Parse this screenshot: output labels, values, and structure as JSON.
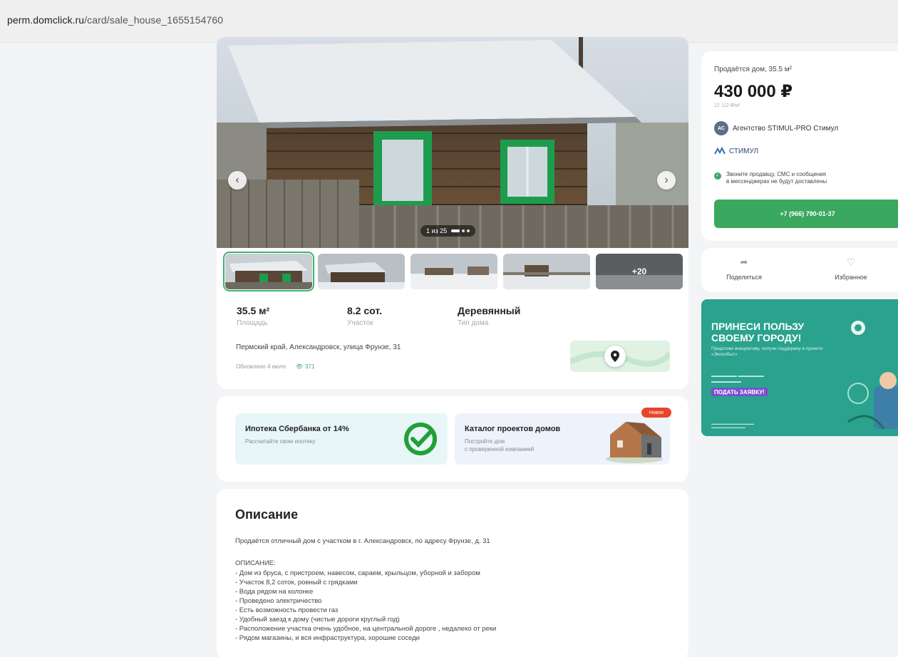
{
  "browser": {
    "url_host": "perm.domclick.ru",
    "url_path": "/card/sale_house_1655154760"
  },
  "gallery": {
    "counter": "1 из 25",
    "more_label": "+20"
  },
  "specs": [
    {
      "value": "35.5 м²",
      "label": "Площадь"
    },
    {
      "value": "8.2 сот.",
      "label": "Участок"
    },
    {
      "value": "Деревянный",
      "label": "Тип дома"
    }
  ],
  "address": "Пермский край, Александровск, улица Фрунзе, 31",
  "updated": "Обновлено 4 июля",
  "views": "371",
  "promos": {
    "mortgage_title": "Ипотека Сбербанка от 14%",
    "mortgage_sub": "Рассчитайте свою ипотеку",
    "catalog_title": "Каталог проектов домов",
    "catalog_sub_1": "Постройте дом",
    "catalog_sub_2": "с проверенной компанией",
    "new_badge": "Новое"
  },
  "description": {
    "title": "Описание",
    "intro": "Продаётся отличный дом с участком в г. Александровск, по адресу Фрунзе, д. 31",
    "heading": "ОПИСАНИЕ:",
    "items": [
      "- Дом из бруса, с пристроем, навесом, сараем, крыльцом, уборной и забором",
      "- Участок 8,2 соток, ровный с грядками",
      "- Вода рядом на колонке",
      "- Проведено электричество",
      "- Есть возможность провести газ",
      "- Удобный заезд к дому (чистые дороги круглый год)",
      "- Расположение участка очень удобное, на центральной дороге , недалеко от реки",
      "- Рядом магазины, и вся инфраструктура, хорошие соседи"
    ]
  },
  "sale": {
    "subtitle": "Продаётся дом, 35.5 м²",
    "price": "430 000 ₽",
    "price_per_sqm": "12 112 ₽/м²",
    "agency_initials": "АС",
    "agency_name": "Агентство STIMUL-PRO Стимул",
    "brand_name": "СТИМУЛ",
    "notice_1": "Звоните продавцу, СМС и сообщения",
    "notice_2": "в мессенджерах не будут доставлены",
    "phone": "+7 (966) 790-01-37"
  },
  "actions": {
    "share": "Поделиться",
    "favorite": "Избранное"
  },
  "ad": {
    "headline_1": "ПРИНЕСИ ПОЛЬЗУ",
    "headline_2": "СВОЕМУ ГОРОДУ!",
    "sub": "Предложи инициативу, получи поддержку в проекте «Экособыт»",
    "cta": "ПОДАТЬ ЗАЯВКУ!"
  },
  "colors": {
    "accent_green": "#3aa85e",
    "ad_teal": "#2aa28d",
    "badge_red": "#e6452b"
  }
}
